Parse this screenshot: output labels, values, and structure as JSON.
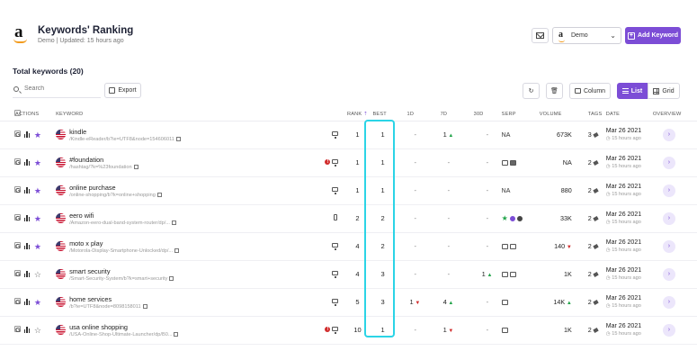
{
  "header": {
    "title": "Keywords' Ranking",
    "subtitle": "Demo | Updated: 15 hours ago",
    "account_select": {
      "value": "Demo",
      "icon": "amazon-logo-icon"
    },
    "add_button": "Add Keyword",
    "mail_icon": "mail-icon",
    "accent_color": "#7c4dd6"
  },
  "summary": {
    "total_keywords": "Total keywords (20)"
  },
  "toolbar": {
    "search_placeholder": "Search",
    "export_label": "Export",
    "column_label": "Column",
    "list_label": "List",
    "grid_label": "Grid"
  },
  "table": {
    "headers": {
      "actions": "ACTIONS",
      "keyword": "KEYWORD",
      "rank": "RANK",
      "best": "BEST",
      "d1": "1D",
      "d7": "7D",
      "d30": "30D",
      "serp": "SERP",
      "volume": "VOLUME",
      "tags": "TAGS",
      "date": "DATE",
      "overview": "OVERVIEW"
    },
    "rows": [
      {
        "keyword": "kindle",
        "url": "/Kindle-eReader/b?ie=UTF8&node=154606011",
        "starred": true,
        "warning": false,
        "device": "desktop",
        "rank": "1",
        "best": "1",
        "d1": "-",
        "d7": "1",
        "d7_dir": "up",
        "d30": "-",
        "serp": "NA",
        "volume": "673K",
        "volume_dir": "",
        "tags": "3",
        "date": "Mar 26 2021",
        "ago": "15 hours ago"
      },
      {
        "keyword": "#foundation",
        "url": "/hashtag/?k=%23foundation",
        "starred": true,
        "warning": true,
        "device": "desktop",
        "rank": "1",
        "best": "1",
        "d1": "-",
        "d7": "-",
        "d7_dir": "",
        "d30": "-",
        "serp": "icons:img,video",
        "volume": "NA",
        "volume_dir": "",
        "tags": "2",
        "date": "Mar 26 2021",
        "ago": "15 hours ago"
      },
      {
        "keyword": "online purchase",
        "url": "/online-shopping/b?k=online+shopping",
        "starred": true,
        "warning": false,
        "device": "desktop",
        "rank": "1",
        "best": "1",
        "d1": "-",
        "d7": "-",
        "d7_dir": "",
        "d30": "-",
        "serp": "NA",
        "volume": "880",
        "volume_dir": "",
        "tags": "2",
        "date": "Mar 26 2021",
        "ago": "15 hours ago"
      },
      {
        "keyword": "eero wifi",
        "url": "/Amazon-eero-dual-band-system-router/dp/...",
        "starred": true,
        "warning": false,
        "device": "mobile",
        "rank": "2",
        "best": "2",
        "d1": "-",
        "d7": "-",
        "d7_dir": "",
        "d30": "-",
        "serp": "icons:star,purple,q",
        "volume": "33K",
        "volume_dir": "",
        "tags": "2",
        "date": "Mar 26 2021",
        "ago": "15 hours ago"
      },
      {
        "keyword": "moto x play",
        "url": "/Motorola-Display-Smartphone-Unlocked/dp/...",
        "starred": true,
        "warning": false,
        "device": "desktop",
        "rank": "4",
        "best": "2",
        "d1": "-",
        "d7": "-",
        "d7_dir": "",
        "d30": "-",
        "serp": "icons:grid,img",
        "volume": "140",
        "volume_dir": "down",
        "tags": "2",
        "date": "Mar 26 2021",
        "ago": "15 hours ago"
      },
      {
        "keyword": "smart security",
        "url": "/Smart-Security-System/b?k=smart+security",
        "starred": false,
        "warning": false,
        "device": "desktop",
        "rank": "4",
        "best": "3",
        "d1": "-",
        "d7": "-",
        "d7_dir": "",
        "d30": "1",
        "d30_dir": "up",
        "serp": "icons:img,img",
        "volume": "1K",
        "volume_dir": "",
        "tags": "2",
        "date": "Mar 26 2021",
        "ago": "15 hours ago"
      },
      {
        "keyword": "home services",
        "url": "/b?ie=UTF8&node=8098158011",
        "starred": true,
        "warning": false,
        "device": "desktop",
        "rank": "5",
        "best": "3",
        "d1": "1",
        "d1_dir": "down",
        "d7": "4",
        "d7_dir": "up",
        "d30": "-",
        "serp": "icons:grid",
        "volume": "14K",
        "volume_dir": "up",
        "tags": "2",
        "date": "Mar 26 2021",
        "ago": "15 hours ago"
      },
      {
        "keyword": "usa online shopping",
        "url": "/USA-Online-Shop-Ultimate-Launcher/dp/B0...",
        "starred": false,
        "warning": true,
        "device": "desktop",
        "rank": "10",
        "best": "1",
        "d1": "-",
        "d7": "1",
        "d7_dir": "down",
        "d30": "-",
        "serp": "icons:img",
        "volume": "1K",
        "volume_dir": "",
        "tags": "2",
        "date": "Mar 26 2021",
        "ago": "15 hours ago"
      }
    ]
  },
  "colors": {
    "up": "#22a44a",
    "down": "#d12c2c",
    "highlight": "#2bd4e6"
  }
}
